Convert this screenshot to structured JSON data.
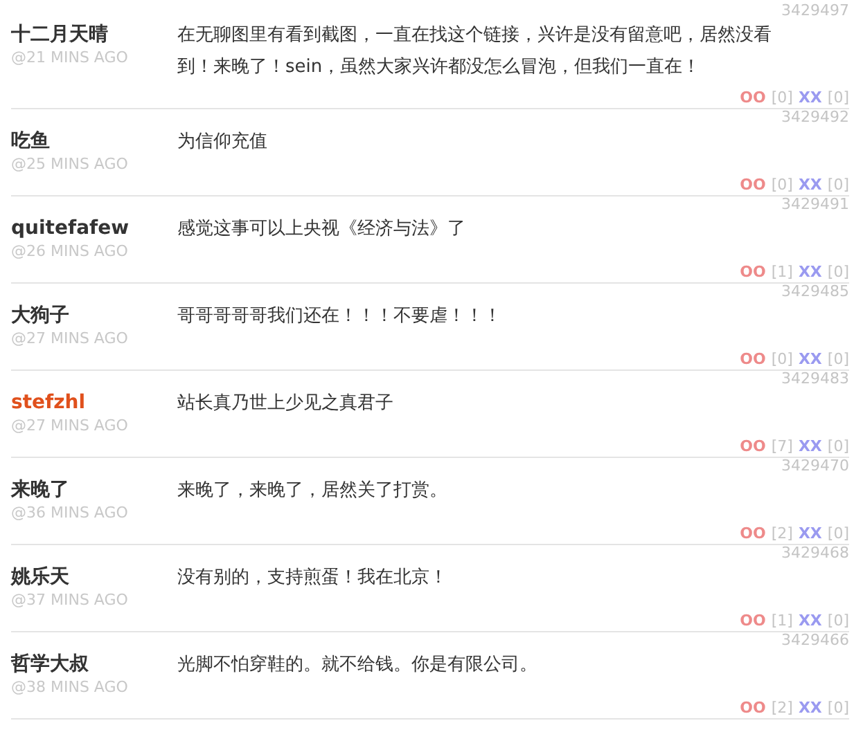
{
  "comments": [
    {
      "id": "3429497",
      "author": "十二月天晴",
      "highlighted": false,
      "time": "@21 MINS AGO",
      "text": "在无聊图里有看到截图，一直在找这个链接，兴许是没有留意吧，居然没看到！来晚了！sein，虽然大家兴许都没怎么冒泡，但我们一直在！",
      "oo_label": "OO",
      "oo_count": "[0]",
      "xx_label": "XX",
      "xx_count": "[0]"
    },
    {
      "id": "3429492",
      "author": "吃鱼",
      "highlighted": false,
      "time": "@25 MINS AGO",
      "text": "为信仰充值",
      "oo_label": "OO",
      "oo_count": "[0]",
      "xx_label": "XX",
      "xx_count": "[0]"
    },
    {
      "id": "3429491",
      "author": "quitefafew",
      "highlighted": false,
      "time": "@26 MINS AGO",
      "text": "感觉这事可以上央视《经济与法》了",
      "oo_label": "OO",
      "oo_count": "[1]",
      "xx_label": "XX",
      "xx_count": "[0]"
    },
    {
      "id": "3429485",
      "author": "大狗子",
      "highlighted": false,
      "time": "@27 MINS AGO",
      "text": "哥哥哥哥哥我们还在！！！不要虐！！！",
      "oo_label": "OO",
      "oo_count": "[0]",
      "xx_label": "XX",
      "xx_count": "[0]"
    },
    {
      "id": "3429483",
      "author": "stefzhl",
      "highlighted": true,
      "time": "@27 MINS AGO",
      "text": "站长真乃世上少见之真君子",
      "oo_label": "OO",
      "oo_count": "[7]",
      "xx_label": "XX",
      "xx_count": "[0]"
    },
    {
      "id": "3429470",
      "author": "来晚了",
      "highlighted": false,
      "time": "@36 MINS AGO",
      "text": "来晚了，来晚了，居然关了打赏。",
      "oo_label": "OO",
      "oo_count": "[2]",
      "xx_label": "XX",
      "xx_count": "[0]"
    },
    {
      "id": "3429468",
      "author": "姚乐天",
      "highlighted": false,
      "time": "@37 MINS AGO",
      "text": "没有别的，支持煎蛋！我在北京！",
      "oo_label": "OO",
      "oo_count": "[1]",
      "xx_label": "XX",
      "xx_count": "[0]"
    },
    {
      "id": "3429466",
      "author": "哲学大叔",
      "highlighted": false,
      "time": "@38 MINS AGO",
      "text": "光脚不怕穿鞋的。就不给钱。你是有限公司。",
      "oo_label": "OO",
      "oo_count": "[2]",
      "xx_label": "XX",
      "xx_count": "[0]"
    }
  ]
}
